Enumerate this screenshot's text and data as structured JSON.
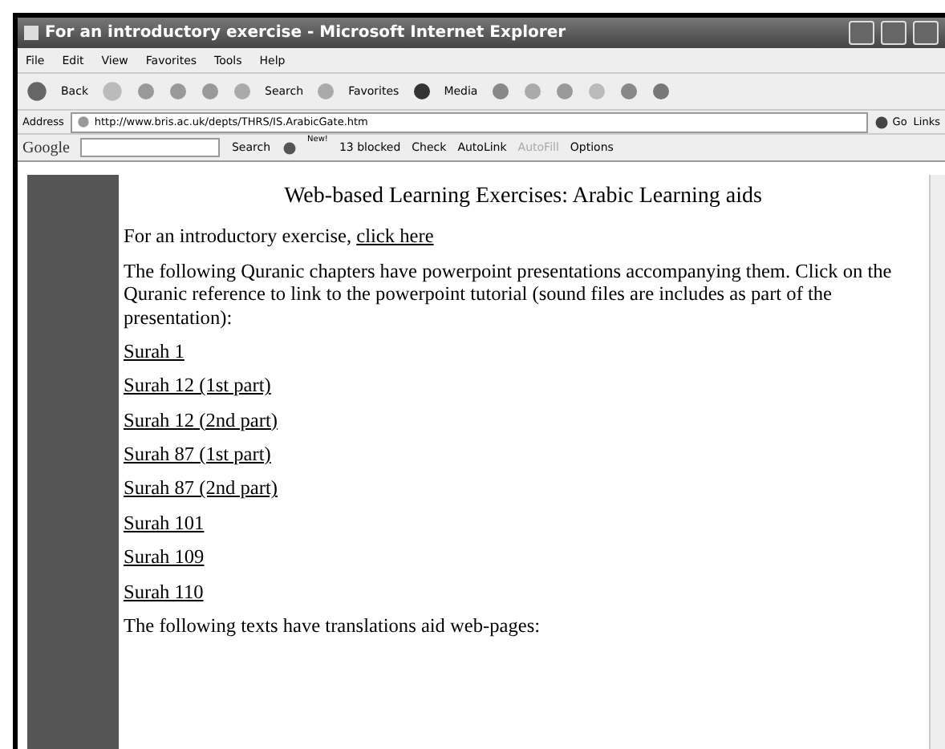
{
  "window": {
    "title": "For an introductory exercise - Microsoft Internet Explorer"
  },
  "menu": [
    "File",
    "Edit",
    "View",
    "Favorites",
    "Tools",
    "Help"
  ],
  "toolbar": {
    "back": "Back",
    "search": "Search",
    "favorites": "Favorites",
    "media": "Media"
  },
  "address": {
    "label": "Address",
    "url": "http://www.bris.ac.uk/depts/THRS/IS.ArabicGate.htm",
    "go": "Go",
    "links": "Links"
  },
  "google_bar": {
    "brand": "Google",
    "search": "Search",
    "new_badge": "New!",
    "blocked": "13 blocked",
    "check": "Check",
    "autolink": "AutoLink",
    "autofill": "AutoFill",
    "options": "Options"
  },
  "page": {
    "heading": "Web-based Learning Exercises:  Arabic Learning aids",
    "intro": "For an introductory exercise,",
    "intro_link": "click here",
    "paragraph": "The following Quranic chapters have powerpoint presentations accompanying them. Click on the Quranic reference to link to the powerpoint tutorial (sound files are includes as part of the presentation):",
    "links": [
      "Surah 1",
      "Surah 12 (1st part)",
      "Surah 12 (2nd part)",
      "Surah 87 (1st part)",
      "Surah 87 (2nd part)",
      "Surah 101",
      "Surah 109",
      "Surah 110"
    ],
    "footer": "The following texts have translations aid web-pages:"
  }
}
